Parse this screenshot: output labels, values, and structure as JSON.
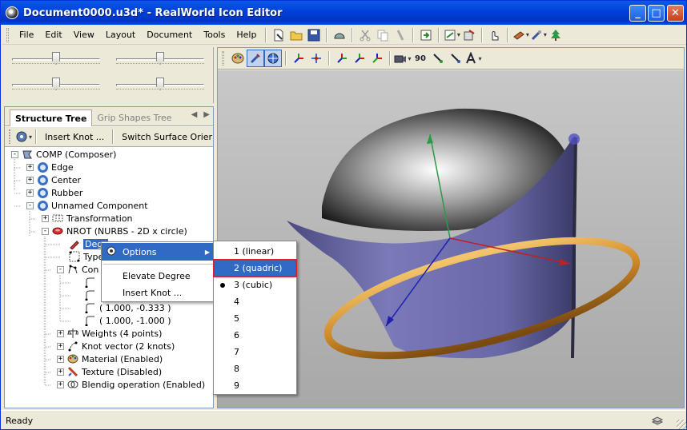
{
  "window": {
    "title": "Document0000.u3d* - RealWorld Icon Editor",
    "minimize_label": "_",
    "maximize_label": "□",
    "close_label": "✕"
  },
  "menubar": {
    "items": [
      "File",
      "Edit",
      "View",
      "Layout",
      "Document",
      "Tools",
      "Help"
    ]
  },
  "toolbar": {
    "icons": [
      "new-document-icon",
      "open-folder-icon",
      "save-icon",
      "ruler-icon",
      "cut-icon",
      "copy-icon",
      "paste-icon",
      "export-icon",
      "import-icon",
      "move-icon",
      "hand-icon",
      "tool-palette-icon",
      "magic-wand-icon",
      "tree-icon"
    ]
  },
  "left_panel": {
    "tabs": [
      "Structure Tree",
      "Grip Shapes Tree"
    ],
    "active_tab": "Structure Tree",
    "toolbar": {
      "insert_knot_label": "Insert Knot ...",
      "switch_surface_label": "Switch Surface Orier",
      "overflow_label": "»"
    },
    "tree": [
      {
        "label": "COMP (Composer)",
        "level": 0,
        "expander": "-"
      },
      {
        "label": "Edge",
        "level": 1,
        "expander": "+"
      },
      {
        "label": "Center",
        "level": 1,
        "expander": "+"
      },
      {
        "label": "Rubber",
        "level": 1,
        "expander": "+"
      },
      {
        "label": "Unnamed Component",
        "level": 1,
        "expander": "-"
      },
      {
        "label": "Transformation",
        "level": 2,
        "expander": "+"
      },
      {
        "label": "NROT (NURBS - 2D x circle)",
        "level": 2,
        "expander": "-"
      },
      {
        "label": "Degr",
        "level": 3,
        "expander": ""
      },
      {
        "label": "Type",
        "level": 3,
        "expander": ""
      },
      {
        "label": "Con",
        "level": 3,
        "expander": "-"
      },
      {
        "label": "",
        "level": 4,
        "expander": ""
      },
      {
        "label": "",
        "level": 4,
        "expander": ""
      },
      {
        "label": "( 1.000, -0.333 )",
        "level": 4,
        "expander": ""
      },
      {
        "label": "( 1.000, -1.000 )",
        "level": 4,
        "expander": ""
      },
      {
        "label": "Weights (4 points)",
        "level": 3,
        "expander": "+"
      },
      {
        "label": "Knot vector (2 knots)",
        "level": 3,
        "expander": "+"
      },
      {
        "label": "Material (Enabled)",
        "level": 3,
        "expander": "+"
      },
      {
        "label": "Texture (Disabled)",
        "level": 3,
        "expander": "+"
      },
      {
        "label": "Blendig operation (Enabled)",
        "level": 3,
        "expander": "+"
      }
    ]
  },
  "context_menu": {
    "items": [
      {
        "label": "Options",
        "has_submenu": true,
        "selected": true
      },
      {
        "label": "Elevate Degree",
        "has_submenu": false,
        "selected": false
      },
      {
        "label": "Insert Knot ...",
        "has_submenu": false,
        "selected": false
      }
    ]
  },
  "submenu": {
    "items": [
      {
        "label": "1 (linear)",
        "checked": false,
        "selected": false
      },
      {
        "label": "2 (quadric)",
        "checked": false,
        "selected": true
      },
      {
        "label": "3 (cubic)",
        "checked": true,
        "selected": false
      },
      {
        "label": "4",
        "checked": false,
        "selected": false
      },
      {
        "label": "5",
        "checked": false,
        "selected": false
      },
      {
        "label": "6",
        "checked": false,
        "selected": false
      },
      {
        "label": "7",
        "checked": false,
        "selected": false
      },
      {
        "label": "8",
        "checked": false,
        "selected": false
      },
      {
        "label": "9",
        "checked": false,
        "selected": false
      }
    ]
  },
  "viewport_toolbar": {
    "icons": [
      "palette-icon",
      "brush-icon",
      "globe-icon",
      "axis-icon",
      "pan-icon",
      "rotate-x-icon",
      "rotate-y-icon",
      "rotate-z-icon",
      "camera-icon",
      "rotate-90-icon",
      "light-icon",
      "spot-icon",
      "text-icon"
    ],
    "rotate_label": "90"
  },
  "status": {
    "text": "Ready"
  },
  "colors": {
    "title_blue": "#0040d8",
    "selection": "#316ac5",
    "highlight_border": "#e0202a",
    "surface": "#6e6ea8",
    "ring": "#d89a3c"
  }
}
